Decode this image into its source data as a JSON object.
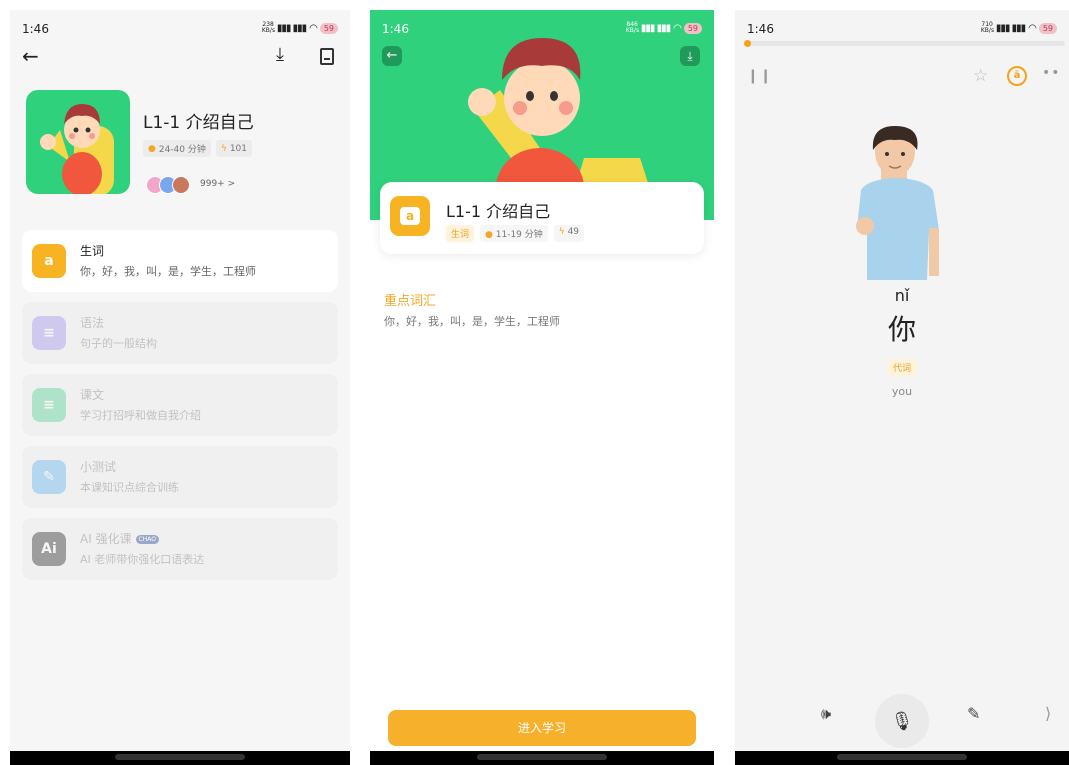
{
  "colors": {
    "green": "#30d17c",
    "orange": "#f7a21a",
    "button": "#f7b02c"
  },
  "panel1": {
    "status": {
      "time": "1:46",
      "speed": "238 KB/s",
      "battery": "59"
    },
    "icons": [
      "back-arrow-icon",
      "download-icon",
      "book-icon"
    ],
    "lesson": {
      "title": "L1-1 介绍自己",
      "duration": "24-40 分钟",
      "energy": "101",
      "learners": "999+ >"
    },
    "modules": [
      {
        "icon": "a",
        "title": "生词",
        "subtitle": "你，好，我，叫，是，学生，工程师",
        "color": "#f7b322",
        "active": true
      },
      {
        "icon": "≡",
        "title": "语法",
        "subtitle": "句子的一般结构",
        "color": "#a99bf2",
        "active": false
      },
      {
        "icon": "≡",
        "title": "课文",
        "subtitle": "学习打招呼和做自我介绍",
        "color": "#5fd49a",
        "active": false
      },
      {
        "icon": "✎",
        "title": "小测试",
        "subtitle": "本课知识点综合训练",
        "color": "#6cb8ee",
        "active": false
      },
      {
        "icon": "Ai",
        "title": "AI 强化课",
        "subtitle": "AI 老师带你强化口语表达",
        "badge": "CHAO",
        "color": "#3b3b3b",
        "active": false
      }
    ]
  },
  "panel2": {
    "status": {
      "time": "1:46",
      "speed": "846 KB/s",
      "battery": "59"
    },
    "card": {
      "icon": "a",
      "title": "L1-1 介绍自己",
      "tag": "生词",
      "duration": "11-19 分钟",
      "energy": "49"
    },
    "key_vocab": {
      "heading": "重点词汇",
      "words": "你，好，我，叫，是，学生，工程师"
    },
    "enter_button": "进入学习"
  },
  "panel3": {
    "status": {
      "time": "1:46",
      "speed": "710 KB/s",
      "battery": "59"
    },
    "progress_fraction": 0.01,
    "word": {
      "pinyin": "nǐ",
      "hanzi": "你",
      "part_of_speech": "代词",
      "meaning": "you"
    },
    "controls": [
      "speaker-icon",
      "microphone-icon",
      "pen-icon",
      "next-icon"
    ]
  }
}
